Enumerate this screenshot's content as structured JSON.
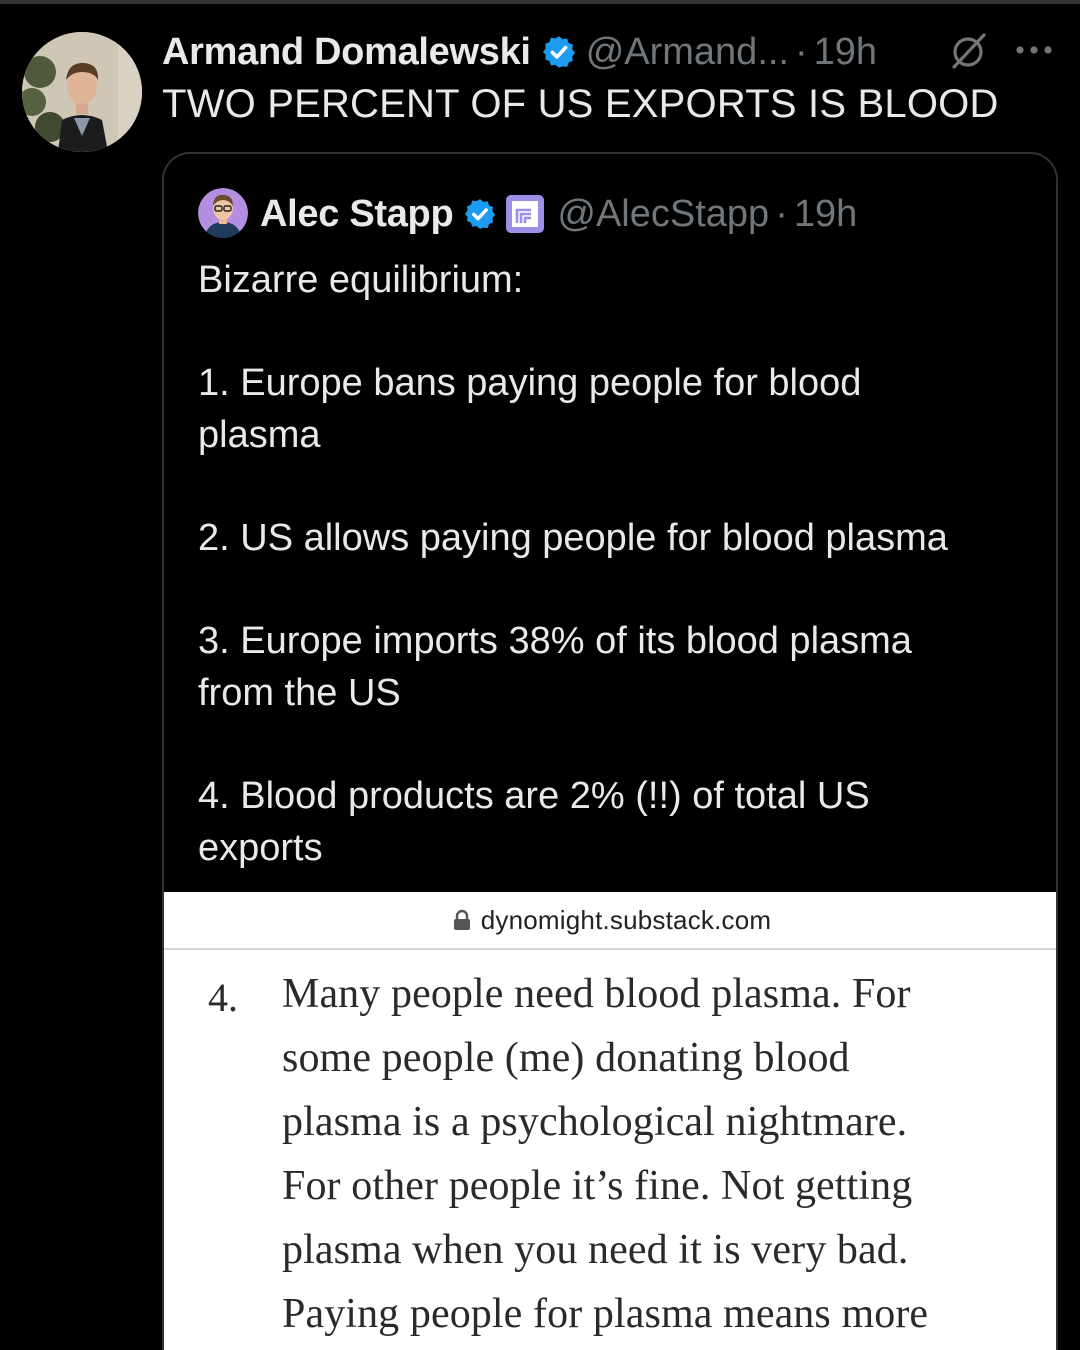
{
  "tweet": {
    "author_name": "Armand Domalewski",
    "handle": "@Armand...",
    "separator": "·",
    "time": "19h",
    "text": "TWO PERCENT OF US EXPORTS IS BLOOD",
    "icons": [
      "verified-badge-icon",
      "grok-icon",
      "more-options-icon"
    ]
  },
  "quoted_tweet": {
    "author_name": "Alec Stapp",
    "handle": "@AlecStapp",
    "separator": "·",
    "time": "19h",
    "body_lines": [
      "Bizarre equilibrium:",
      "",
      "1. Europe bans paying people for blood",
      "plasma",
      "",
      "2. US allows paying people for blood plasma",
      "",
      "3. Europe imports 38% of its blood plasma",
      "from the US",
      "",
      "4. Blood products are 2% (!!) of total US",
      "exports"
    ],
    "icons": [
      "verified-badge-icon",
      "affiliate-badge-icon"
    ]
  },
  "screenshot": {
    "url": "dynomight.substack.com",
    "item_number": "4.",
    "lines": [
      "Many people need blood plasma. For",
      "some people (me) donating blood",
      "plasma is a psychological nightmare.",
      "For other people it’s fine. Not getting",
      "plasma when you need it is very bad.",
      "Paying people for plasma means more"
    ]
  },
  "colors": {
    "background": "#000000",
    "text_primary": "#e7e9ea",
    "text_secondary": "#71767b",
    "border": "#2f3336",
    "verified_blue": "#1d9bf0",
    "affiliate_purple": "#9b8fe8"
  }
}
